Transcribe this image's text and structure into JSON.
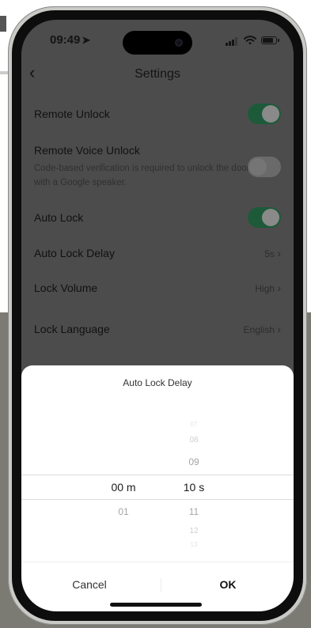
{
  "status": {
    "time": "09:49",
    "location_arrow": "location-arrow-icon"
  },
  "header": {
    "back": "‹",
    "title": "Settings"
  },
  "settings": [
    {
      "label": "Remote Unlock",
      "type": "toggle",
      "state": "on"
    },
    {
      "label": "Remote Voice Unlock",
      "description": "Code-based verification is required to unlock the door with a Google speaker.",
      "type": "toggle",
      "state": "off"
    },
    {
      "label": "Auto Lock",
      "type": "toggle",
      "state": "on"
    },
    {
      "label": "Auto Lock Delay",
      "value": "5s"
    },
    {
      "label": "Lock Volume",
      "value": "High"
    },
    {
      "label": "Lock Language",
      "value": "English"
    }
  ],
  "sheet": {
    "title": "Auto Lock Delay",
    "minutes": {
      "selected": "00 m",
      "below": "01"
    },
    "seconds": {
      "above_far": "07",
      "above_mid": "08",
      "above_near": "09",
      "selected": "10 s",
      "below_near": "11",
      "below_mid": "12",
      "below_far": "13"
    },
    "cancel_label": "Cancel",
    "ok_label": "OK"
  },
  "colors": {
    "toggle_on": "#1d5a3a",
    "overlay": "#4c4c4c"
  }
}
